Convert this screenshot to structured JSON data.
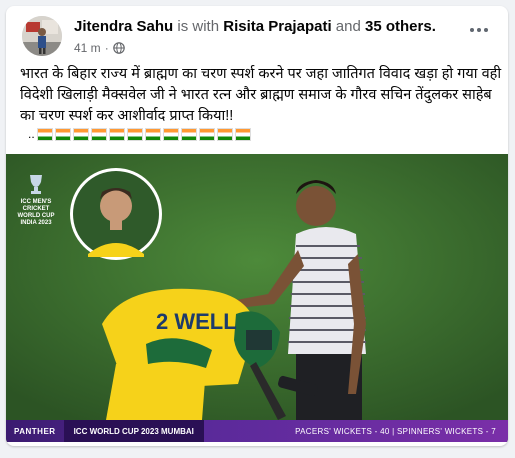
{
  "post": {
    "author": "Jitendra Sahu",
    "with_text": "is with",
    "tagged": "Risita Prajapati",
    "and_text": "and",
    "others": "35 others.",
    "time": "41 m",
    "text": "भारत के बिहार राज्य में ब्राह्मण का चरण स्पर्श करने पर जहा जातिगत विवाद खड़ा हो गया वही विदेशी खिलाड़ी मैक्सवेल जी ने भारत रत्न और ब्राह्मण समाज के गौरव सचिन तेंदुलकर साहेब का चरण स्पर्श कर आशीर्वाद प्राप्त किया!!",
    "flags_prefix": "..",
    "flag_count": 12,
    "flag_color_top": "#ff9933",
    "flag_color_bottom": "#138808"
  },
  "image": {
    "logo_lines": [
      "ICC MEN'S",
      "CRICKET",
      "WORLD CUP",
      "INDIA 2023"
    ],
    "jersey_text": "2  WELL",
    "scorebar": {
      "brand": "PANTHER",
      "event": "ICC WORLD CUP 2023   MUMBAI",
      "stats": "PACERS' WICKETS - 40  |  SPINNERS' WICKETS - 7"
    }
  },
  "icons": {
    "more": "more-options-icon",
    "privacy": "globe-icon"
  },
  "colors": {
    "accent_purple": "#5a2a9a",
    "pitch_green": "#3a6a2d",
    "aus_yellow": "#f6d21a"
  }
}
